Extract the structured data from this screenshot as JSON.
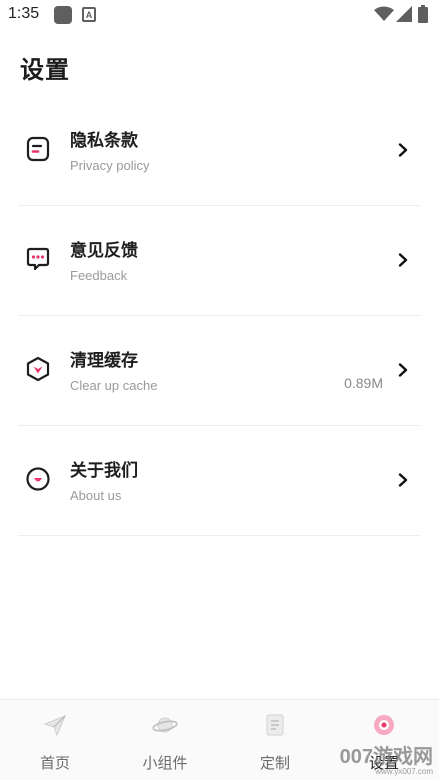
{
  "status_bar": {
    "time": "1:35",
    "a_glyph": "A",
    "icons": [
      "app-square-icon",
      "a-notification-icon",
      "wifi-icon",
      "signal-icon",
      "battery-icon"
    ]
  },
  "page": {
    "title": "设置"
  },
  "settings": {
    "items": [
      {
        "title": "隐私条款",
        "subtitle": "Privacy policy",
        "value": "",
        "icon": "privacy-document-icon"
      },
      {
        "title": "意见反馈",
        "subtitle": "Feedback",
        "value": "",
        "icon": "chat-bubble-icon"
      },
      {
        "title": "清理缓存",
        "subtitle": "Clear up cache",
        "value": "0.89M",
        "icon": "cube-icon"
      },
      {
        "title": "关于我们",
        "subtitle": "About us",
        "value": "",
        "icon": "smile-circle-icon"
      }
    ]
  },
  "tabbar": {
    "tabs": [
      {
        "label": "首页",
        "icon": "paper-plane-icon",
        "active": false
      },
      {
        "label": "小组件",
        "icon": "planet-icon",
        "active": false
      },
      {
        "label": "定制",
        "icon": "note-icon",
        "active": false
      },
      {
        "label": "设置",
        "icon": "settings-ring-icon",
        "active": true
      }
    ]
  },
  "watermark": {
    "main": "007游戏网",
    "url": "www.yx007.com"
  },
  "colors": {
    "accent": "#e8366b",
    "text": "#1e1e1e",
    "subtext": "#9a9a9a",
    "divider": "#eeeeee"
  }
}
